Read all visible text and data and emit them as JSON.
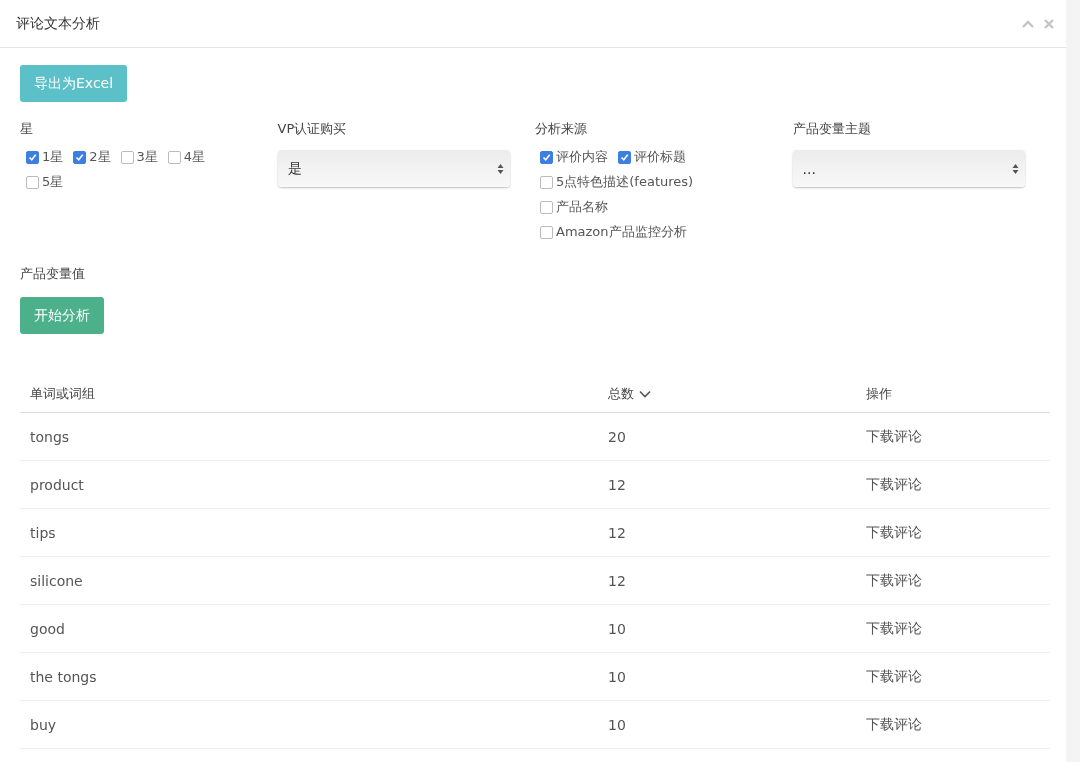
{
  "window": {
    "title": "评论文本分析"
  },
  "export_button": "导出为Excel",
  "filters": [
    {
      "kind": "checks",
      "label": "星",
      "options": [
        {
          "label": "1星",
          "checked": true
        },
        {
          "label": "2星",
          "checked": true
        },
        {
          "label": "3星",
          "checked": false
        },
        {
          "label": "4星",
          "checked": false
        },
        {
          "label": "5星",
          "checked": false
        }
      ]
    },
    {
      "kind": "select",
      "label": "VP认证购买",
      "value": "是"
    },
    {
      "kind": "checks",
      "label": "分析来源",
      "options": [
        {
          "label": "评价内容",
          "checked": true
        },
        {
          "label": "评价标题",
          "checked": true
        },
        {
          "label": "5点特色描述(features)",
          "checked": false
        },
        {
          "label": "产品名称",
          "checked": false
        },
        {
          "label": "Amazon产品监控分析",
          "checked": false
        }
      ]
    },
    {
      "kind": "select",
      "label": "产品变量主题",
      "value": "..."
    }
  ],
  "variable_label": "产品变量值",
  "start_button": "开始分析",
  "table": {
    "columns": [
      {
        "label": "单词或词组"
      },
      {
        "label": "总数",
        "sorted": true
      },
      {
        "label": "操作"
      }
    ],
    "rows": [
      {
        "term": "tongs",
        "total": "20",
        "action": "下载评论"
      },
      {
        "term": "product",
        "total": "12",
        "action": "下载评论"
      },
      {
        "term": "tips",
        "total": "12",
        "action": "下载评论"
      },
      {
        "term": "silicone",
        "total": "12",
        "action": "下载评论"
      },
      {
        "term": "good",
        "total": "10",
        "action": "下载评论"
      },
      {
        "term": "the tongs",
        "total": "10",
        "action": "下载评论"
      },
      {
        "term": "buy",
        "total": "10",
        "action": "下载评论"
      }
    ]
  }
}
